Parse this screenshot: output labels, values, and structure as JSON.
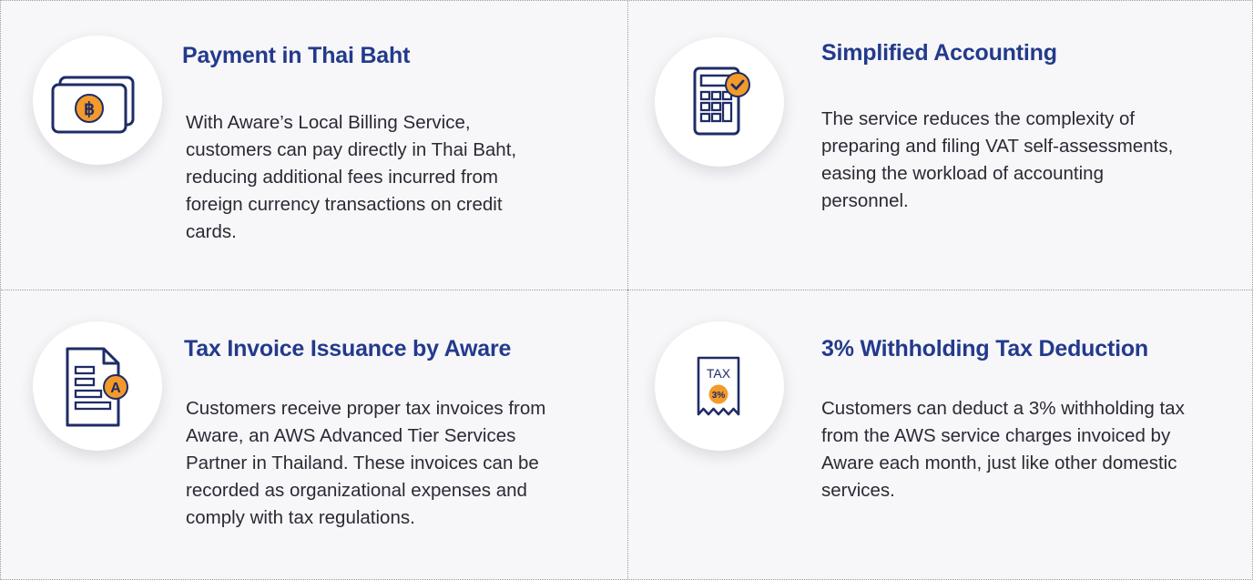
{
  "cards": [
    {
      "title": "Payment in Thai Baht",
      "description": "With Aware’s Local Billing Service, customers can pay directly in Thai Baht, reducing additional fees incurred from foreign currency transactions on credit cards.",
      "icon": "baht-bills-icon",
      "badge_text": "฿"
    },
    {
      "title": "Simplified Accounting",
      "description": "The service reduces the complexity of preparing and filing VAT self-assessments, easing the workload of accounting personnel.",
      "icon": "calculator-check-icon"
    },
    {
      "title": "Tax Invoice Issuance by Aware",
      "description": "Customers receive proper tax invoices from Aware, an AWS Advanced Tier Services Partner in Thailand. These invoices can be recorded as organizational expenses and comply with tax regulations.",
      "icon": "document-invoice-icon",
      "badge_text": "A"
    },
    {
      "title": "3% Withholding Tax Deduction",
      "description": "Customers can deduct a 3% withholding tax from the AWS service charges invoiced by Aware each month, just like other domestic services.",
      "icon": "tax-receipt-icon",
      "receipt_label": "TAX",
      "badge_text": "3%"
    }
  ],
  "colors": {
    "title": "#233a8c",
    "icon_stroke": "#1f2c66",
    "accent": "#f39a2b",
    "background": "#f7f7f9",
    "border": "#9a9aa6"
  }
}
